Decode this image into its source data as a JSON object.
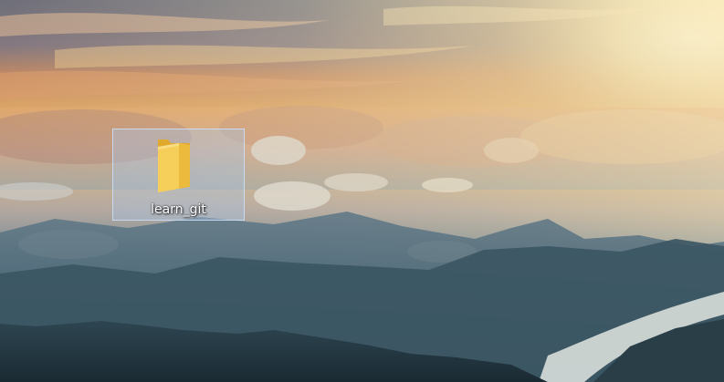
{
  "desktop": {
    "wallpaper": {
      "icon": "sunset-mountains-wallpaper",
      "sky_top": "#4a4a6a",
      "sky_mid": "#e88a3a",
      "sun": "#fff3c8",
      "cloud_sea": "#c9b6a6",
      "mountain_dark": "#233742",
      "valley_haze": "#7fa6b8"
    },
    "icons": [
      {
        "label": "learn_git",
        "icon": "folder-icon",
        "selected": true,
        "folder_color": "#f2c94c"
      }
    ]
  }
}
